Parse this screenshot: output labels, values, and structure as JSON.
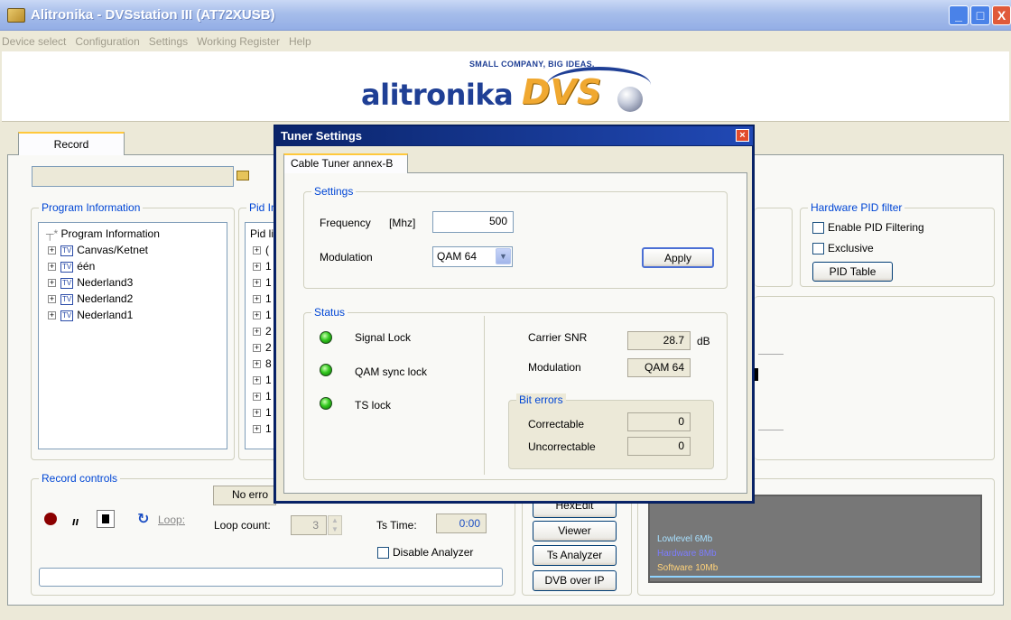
{
  "window": {
    "title": "Alitronika - DVSstation III  (AT72XUSB)"
  },
  "menu": [
    "Device select",
    "Configuration",
    "Settings",
    "Working Register",
    "Help"
  ],
  "logo": {
    "tagline": "SMALL COMPANY, BIG IDEAS.",
    "word": "alitronika",
    "dvs": "DVS"
  },
  "main": {
    "tab_record": "Record",
    "program_info": {
      "title": "Program Information",
      "root": "Program Information",
      "items": [
        "Canvas/Ketnet",
        "één",
        "Nederland3",
        "Nederland2",
        "Nederland1"
      ]
    },
    "pid_info": {
      "title": "Pid In",
      "header": "Pid li",
      "rows": [
        "(",
        "1",
        "1",
        "1",
        "1",
        "2",
        "2",
        "8",
        "1",
        "1",
        "1",
        "1"
      ]
    },
    "hardware_pid": {
      "title": "Hardware PID filter",
      "enable_label": "Enable PID Filtering",
      "exclusive_label": "Exclusive",
      "pid_table_button": "PID Table"
    },
    "record_controls": {
      "title": "Record controls",
      "status_text": "No erro",
      "loop_label": "Loop:",
      "loop_count_label": "Loop count:",
      "loop_count_value": "3",
      "ts_time_label": "Ts Time:",
      "ts_time_value": "0:00",
      "disable_analyzer_label": "Disable Analyzer"
    },
    "side_buttons": {
      "hexedit": "HexEdit",
      "viewer": "Viewer",
      "ts_analyzer": "Ts Analyzer",
      "dvb_over_ip": "DVB over IP"
    },
    "analyzer_legend": [
      "Lowlevel 6Mb",
      "Hardware 8Mb",
      "Software 10Mb"
    ]
  },
  "dialog": {
    "title": "Tuner Settings",
    "tab": "Cable Tuner annex-B",
    "settings": {
      "title": "Settings",
      "frequency_label": "Frequency",
      "frequency_unit": "[Mhz]",
      "frequency_value": "500",
      "modulation_label": "Modulation",
      "modulation_value": "QAM 64",
      "apply_button": "Apply"
    },
    "status": {
      "title": "Status",
      "signal_lock": "Signal Lock",
      "qam_sync_lock": "QAM sync lock",
      "ts_lock": "TS lock",
      "carrier_snr_label": "Carrier SNR",
      "carrier_snr_value": "28.7",
      "carrier_snr_unit": "dB",
      "modulation_label": "Modulation",
      "modulation_value": "QAM 64",
      "bit_errors": {
        "title": "Bit errors",
        "correctable_label": "Correctable",
        "correctable_value": "0",
        "uncorrectable_label": "Uncorrectable",
        "uncorrectable_value": "0"
      }
    }
  },
  "colors": {
    "group_title": "#0046d5",
    "dialog_title": "#0a246a",
    "led_on": "#33c91f",
    "record_dot": "#8b0000"
  }
}
